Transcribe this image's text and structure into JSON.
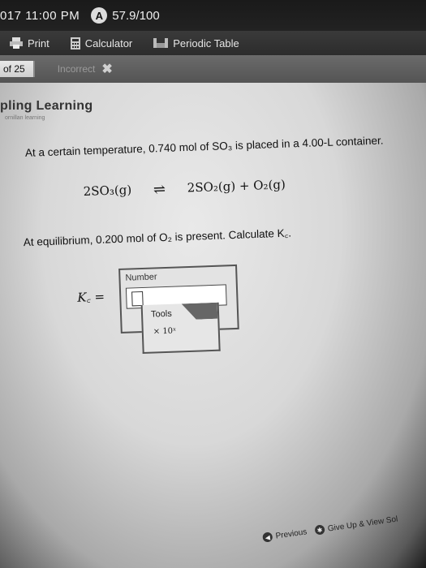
{
  "status": {
    "time": "017 11:00 PM",
    "badge": "A",
    "value": "57.9/100"
  },
  "toolbar": {
    "print": "Print",
    "calculator": "Calculator",
    "periodic": "Periodic Table"
  },
  "question_bar": {
    "count": "of 25",
    "status": "Incorrect"
  },
  "brand": {
    "name": "pling Learning",
    "sub": "ornillan learning"
  },
  "problem": {
    "line1": "At a certain temperature, 0.740 mol of SO₃ is placed in a 4.00-L container.",
    "reaction_left": "2SO₃(g)",
    "reaction_right": "2SO₂(g) + O₂(g)",
    "line2": "At equilibrium, 0.200 mol of O₂ is present. Calculate K꜀."
  },
  "answer": {
    "kc_label": "K꜀ =",
    "number_label": "Number",
    "tools_label": "Tools",
    "x10_label": "× 10ˣ"
  },
  "bottom": {
    "previous": "Previous",
    "giveup": "Give Up & View Sol"
  }
}
